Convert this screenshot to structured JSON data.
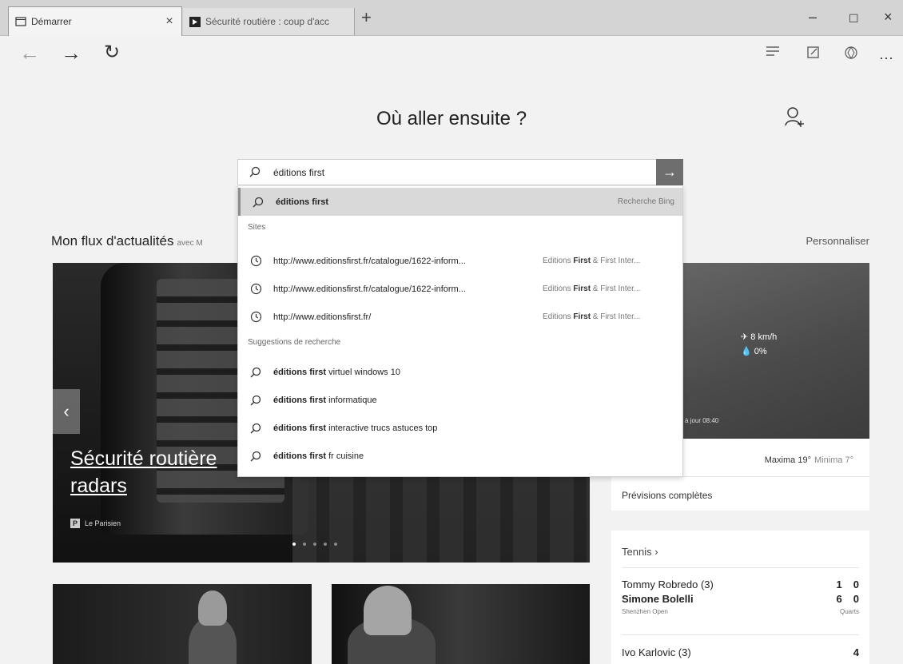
{
  "tabs": [
    {
      "title": "Démarrer",
      "close": "×"
    },
    {
      "title": "Sécurité routière : coup d'acc"
    }
  ],
  "tabbar": {
    "new_tab": "+"
  },
  "window": {
    "minimize": "–",
    "maximize": "☐",
    "close": "×"
  },
  "nav": {
    "back": "←",
    "forward": "→",
    "refresh": "↻",
    "more": "···"
  },
  "page": {
    "heading": "Où aller ensuite ?",
    "feed_title": "Mon flux d'actualités",
    "feed_suffix": "avec M",
    "personalize": "Personnaliser"
  },
  "search": {
    "value": "éditions first",
    "go": "→",
    "top_suggestion": {
      "text": "éditions first",
      "engine": "Recherche Bing"
    },
    "sites_label": "Sites",
    "sites": [
      {
        "url": "http://www.editionsfirst.fr/catalogue/1622-inform...",
        "title_pre": "Editions ",
        "title_bold": "First",
        "title_post": " & First Inter..."
      },
      {
        "url": "http://www.editionsfirst.fr/catalogue/1622-inform...",
        "title_pre": "Editions ",
        "title_bold": "First",
        "title_post": " & First Inter..."
      },
      {
        "url": "http://www.editionsfirst.fr/",
        "title_pre": "Editions ",
        "title_bold": "First",
        "title_post": " & First Inter..."
      }
    ],
    "suggestions_label": "Suggestions de recherche",
    "suggestions": [
      {
        "bold": "éditions first",
        "rest": " virtuel windows 10"
      },
      {
        "bold": "éditions first",
        "rest": " informatique"
      },
      {
        "bold": "éditions first",
        "rest": " interactive trucs astuces top"
      },
      {
        "bold": "éditions first",
        "rest": " fr cuisine"
      }
    ]
  },
  "hero": {
    "headline_line1": "Sécurité routière",
    "headline_line2": "radars",
    "source": "Le Parisien",
    "source_logo": "P",
    "prev": "‹"
  },
  "weather": {
    "wind": "8 km/h",
    "rain": "0%",
    "updated": "à jour 08:40",
    "max": "Maxima 19°",
    "min": "Minima 7°",
    "forecast_link": "Prévisions complètes"
  },
  "tennis": {
    "title": "Tennis ›",
    "matches": [
      {
        "players": [
          {
            "name": "Tommy Robredo (3)",
            "s1": "1",
            "s2": "0"
          },
          {
            "name": "Simone Bolelli",
            "s1": "6",
            "s2": "0"
          }
        ],
        "tournament": "Shenzhen Open",
        "round": "Quarts"
      },
      {
        "players": [
          {
            "name": "Ivo Karlovic (3)",
            "s1": "",
            "s2": "4"
          }
        ]
      }
    ]
  },
  "colors": {
    "accent_bar": "#8c8c8c",
    "go_button": "#6e6e6e"
  }
}
